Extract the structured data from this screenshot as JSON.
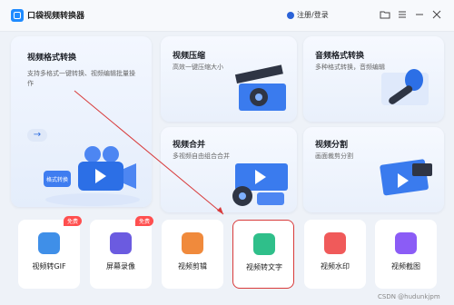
{
  "app": {
    "name": "口袋视频转换器"
  },
  "header": {
    "login": "注册/登录"
  },
  "features": {
    "video_format": {
      "title": "视频格式转换",
      "desc": "支持多格式一键转换、视频编辑批量操作",
      "illus_label": "格式转换"
    },
    "video_compress": {
      "title": "视频压缩",
      "desc": "高效一键压缩大小"
    },
    "audio_format": {
      "title": "音频格式转换",
      "desc": "多种格式转换，音频编辑"
    },
    "video_merge": {
      "title": "视频合并",
      "desc": "多视频自由组合合并"
    },
    "video_split": {
      "title": "视频分割",
      "desc": "画面裁剪分割"
    }
  },
  "tools": [
    {
      "label": "视频转GIF",
      "badge": "免费",
      "color": "#3f8fe8"
    },
    {
      "label": "屏幕录像",
      "badge": "免费",
      "color": "#6b5be0"
    },
    {
      "label": "视频剪辑",
      "badge": "",
      "color": "#f08a3c"
    },
    {
      "label": "视频转文字",
      "badge": "",
      "color": "#2fbf8a"
    },
    {
      "label": "视频水印",
      "badge": "",
      "color": "#f05a5a"
    },
    {
      "label": "视频截图",
      "badge": "",
      "color": "#8b5cf6"
    }
  ],
  "watermark": "CSDN @hudunkjpm"
}
